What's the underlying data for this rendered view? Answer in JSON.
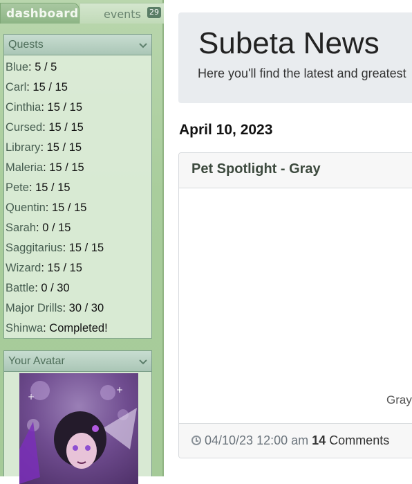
{
  "tabs": {
    "dashboard": "dashboard",
    "events": "events",
    "events_badge": "29"
  },
  "quests": {
    "title": "Quests",
    "items": [
      {
        "name": "Blue",
        "value": ": 5 / 5"
      },
      {
        "name": "Carl",
        "value": ": 15 / 15"
      },
      {
        "name": "Cinthia",
        "value": ": 15 / 15"
      },
      {
        "name": "Cursed",
        "value": ": 15 / 15"
      },
      {
        "name": "Library",
        "value": ": 15 / 15"
      },
      {
        "name": "Maleria",
        "value": ": 15 / 15"
      },
      {
        "name": "Pete",
        "value": ": 15 / 15"
      },
      {
        "name": "Quentin",
        "value": ": 15 / 15"
      },
      {
        "name": "Sarah",
        "value": ": 0 / 15"
      },
      {
        "name": "Saggitarius",
        "value": ": 15 / 15"
      },
      {
        "name": "Wizard",
        "value": ": 15 / 15"
      },
      {
        "name": "Battle",
        "value": ": 0 / 30"
      },
      {
        "name": "Major Drills",
        "value": ": 30 / 30"
      },
      {
        "name": "Shinwa",
        "value": ": Completed!"
      }
    ]
  },
  "avatar": {
    "title": "Your Avatar"
  },
  "news": {
    "title": "Subeta News",
    "subtitle": "Here you'll find the latest and greatest",
    "date": "April 10, 2023",
    "post_title": "Pet Spotlight - Gray",
    "image_caption": "Gray",
    "timestamp": "04/10/23 12:00 am",
    "comment_count": "14",
    "comments_label": "Comments"
  },
  "colors": {
    "sidebar_bg": "#a9cd9c",
    "panel_header": "#aac6b6",
    "jumbotron_bg": "#e9ecef"
  }
}
